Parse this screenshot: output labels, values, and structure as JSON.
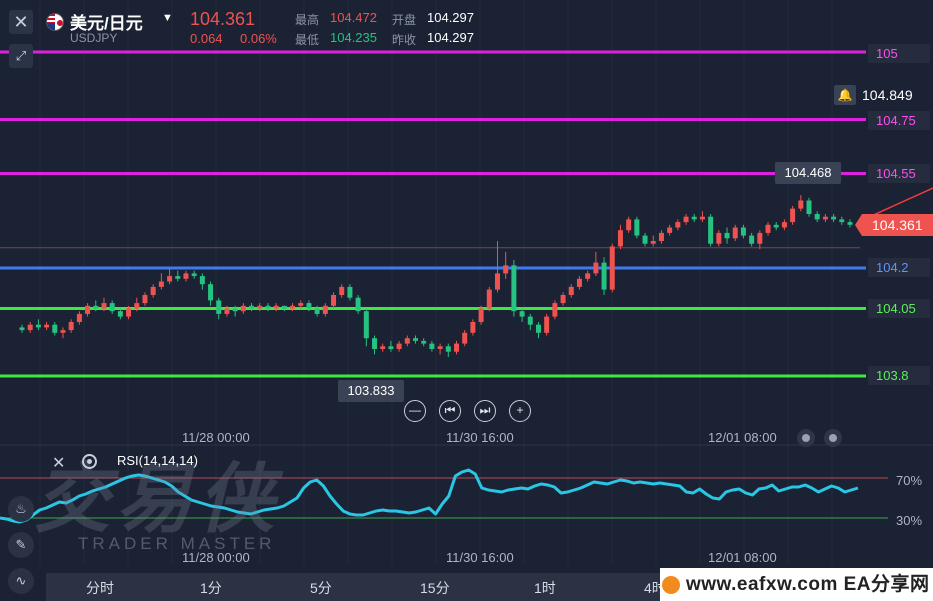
{
  "header": {
    "symbol_name": "美元/日元",
    "symbol_code": "USDJPY",
    "price": "104.361",
    "change": "0.064",
    "change_pct": "0.06%",
    "high_label": "最高",
    "high_value": "104.472",
    "low_label": "最低",
    "low_value": "104.235",
    "open_label": "开盘",
    "open_value": "104.297",
    "prev_close_label": "昨收",
    "prev_close_value": "104.297"
  },
  "price_lines": [
    {
      "label": "105",
      "color": "#e020e0"
    },
    {
      "label": "104.75",
      "color": "#e020e0"
    },
    {
      "label": "104.55",
      "color": "#e020e0"
    },
    {
      "label": "104.2",
      "color": "#3d7bf0"
    },
    {
      "label": "104.05",
      "color": "#3fe83f"
    },
    {
      "label": "103.8",
      "color": "#3fe83f"
    }
  ],
  "alert_price": "104.849",
  "current_price_tag": "104.361",
  "visible_high": "104.468",
  "visible_low": "103.833",
  "time_axis_main": [
    "11/28 00:00",
    "11/30 16:00",
    "12/01 08:00"
  ],
  "time_axis_rsi": [
    "11/28 00:00",
    "11/30 16:00",
    "12/01 08:00"
  ],
  "rsi": {
    "label": "RSI(14,14,14)",
    "upper": "70%",
    "lower": "30%",
    "upper_level": 70,
    "lower_level": 30,
    "line_color": "#29c7e6"
  },
  "watermark": {
    "title": "交易侠",
    "subtitle": "TRADER MASTER"
  },
  "timeframes": [
    "分时",
    "1分",
    "5分",
    "15分",
    "1时",
    "4时"
  ],
  "brand": "www.eafxw.com   EA分享网",
  "colors": {
    "up": "#ef5350",
    "down": "#26c281",
    "bg": "#1b2233"
  },
  "candles": [
    [
      103.98,
      103.97,
      103.99,
      103.96
    ],
    [
      103.97,
      103.99,
      104.0,
      103.96
    ],
    [
      103.99,
      103.98,
      104.01,
      103.97
    ],
    [
      103.98,
      103.99,
      104.0,
      103.97
    ],
    [
      103.99,
      103.96,
      104.0,
      103.95
    ],
    [
      103.96,
      103.97,
      103.98,
      103.94
    ],
    [
      103.97,
      104.0,
      104.01,
      103.96
    ],
    [
      104.0,
      104.03,
      104.04,
      103.99
    ],
    [
      104.03,
      104.06,
      104.07,
      104.02
    ],
    [
      104.06,
      104.05,
      104.08,
      104.04
    ],
    [
      104.05,
      104.07,
      104.09,
      104.04
    ],
    [
      104.07,
      104.04,
      104.08,
      104.03
    ],
    [
      104.04,
      104.02,
      104.05,
      104.01
    ],
    [
      104.02,
      104.05,
      104.06,
      104.01
    ],
    [
      104.05,
      104.07,
      104.09,
      104.04
    ],
    [
      104.07,
      104.1,
      104.11,
      104.06
    ],
    [
      104.1,
      104.13,
      104.14,
      104.09
    ],
    [
      104.13,
      104.15,
      104.18,
      104.12
    ],
    [
      104.15,
      104.17,
      104.2,
      104.14
    ],
    [
      104.17,
      104.16,
      104.19,
      104.15
    ],
    [
      104.16,
      104.18,
      104.19,
      104.15
    ],
    [
      104.18,
      104.17,
      104.19,
      104.16
    ],
    [
      104.17,
      104.14,
      104.18,
      104.12
    ],
    [
      104.14,
      104.08,
      104.15,
      104.06
    ],
    [
      104.08,
      104.03,
      104.09,
      104.01
    ],
    [
      104.03,
      104.05,
      104.06,
      104.02
    ],
    [
      104.05,
      104.04,
      104.06,
      104.02
    ],
    [
      104.04,
      104.06,
      104.07,
      104.03
    ],
    [
      104.06,
      104.05,
      104.07,
      104.04
    ],
    [
      104.05,
      104.06,
      104.07,
      104.04
    ],
    [
      104.06,
      104.05,
      104.07,
      104.04
    ],
    [
      104.05,
      104.06,
      104.07,
      104.04
    ],
    [
      104.06,
      104.05,
      104.06,
      104.04
    ],
    [
      104.05,
      104.06,
      104.07,
      104.04
    ],
    [
      104.06,
      104.07,
      104.08,
      104.05
    ],
    [
      104.07,
      104.05,
      104.08,
      104.04
    ],
    [
      104.05,
      104.03,
      104.06,
      104.02
    ],
    [
      104.03,
      104.06,
      104.07,
      104.02
    ],
    [
      104.06,
      104.1,
      104.11,
      104.05
    ],
    [
      104.1,
      104.13,
      104.14,
      104.09
    ],
    [
      104.13,
      104.09,
      104.14,
      104.08
    ],
    [
      104.09,
      104.04,
      104.1,
      104.03
    ],
    [
      104.04,
      103.94,
      104.05,
      103.91
    ],
    [
      103.94,
      103.9,
      103.95,
      103.88
    ],
    [
      103.9,
      103.91,
      103.92,
      103.89
    ],
    [
      103.91,
      103.9,
      103.93,
      103.89
    ],
    [
      103.9,
      103.92,
      103.93,
      103.89
    ],
    [
      103.92,
      103.94,
      103.95,
      103.91
    ],
    [
      103.94,
      103.93,
      103.95,
      103.92
    ],
    [
      103.93,
      103.92,
      103.94,
      103.91
    ],
    [
      103.92,
      103.9,
      103.93,
      103.89
    ],
    [
      103.9,
      103.91,
      103.92,
      103.88
    ],
    [
      103.91,
      103.89,
      103.92,
      103.87
    ],
    [
      103.89,
      103.92,
      103.93,
      103.88
    ],
    [
      103.92,
      103.96,
      103.97,
      103.91
    ],
    [
      103.96,
      104.0,
      104.01,
      103.95
    ],
    [
      104.0,
      104.05,
      104.06,
      103.99
    ],
    [
      104.05,
      104.12,
      104.13,
      104.04
    ],
    [
      104.12,
      104.18,
      104.3,
      104.11
    ],
    [
      104.18,
      104.21,
      104.26,
      104.16
    ],
    [
      104.21,
      104.04,
      104.23,
      104.02
    ],
    [
      104.04,
      104.02,
      104.05,
      104.0
    ],
    [
      104.02,
      103.99,
      104.03,
      103.97
    ],
    [
      103.99,
      103.96,
      104.0,
      103.94
    ],
    [
      103.96,
      104.02,
      104.03,
      103.95
    ],
    [
      104.02,
      104.07,
      104.08,
      104.01
    ],
    [
      104.07,
      104.1,
      104.11,
      104.06
    ],
    [
      104.1,
      104.13,
      104.14,
      104.09
    ],
    [
      104.13,
      104.16,
      104.17,
      104.12
    ],
    [
      104.16,
      104.18,
      104.19,
      104.15
    ],
    [
      104.18,
      104.22,
      104.26,
      104.17
    ],
    [
      104.22,
      104.12,
      104.24,
      104.1
    ],
    [
      104.12,
      104.28,
      104.29,
      104.11
    ],
    [
      104.28,
      104.34,
      104.36,
      104.27
    ],
    [
      104.34,
      104.38,
      104.39,
      104.33
    ],
    [
      104.38,
      104.32,
      104.39,
      104.31
    ],
    [
      104.32,
      104.29,
      104.33,
      104.28
    ],
    [
      104.29,
      104.3,
      104.32,
      104.28
    ],
    [
      104.3,
      104.33,
      104.34,
      104.29
    ],
    [
      104.33,
      104.35,
      104.36,
      104.32
    ],
    [
      104.35,
      104.37,
      104.38,
      104.34
    ],
    [
      104.37,
      104.39,
      104.4,
      104.36
    ],
    [
      104.39,
      104.38,
      104.4,
      104.37
    ],
    [
      104.38,
      104.39,
      104.41,
      104.37
    ],
    [
      104.39,
      104.29,
      104.4,
      104.28
    ],
    [
      104.29,
      104.33,
      104.34,
      104.28
    ],
    [
      104.33,
      104.31,
      104.35,
      104.29
    ],
    [
      104.31,
      104.35,
      104.36,
      104.3
    ],
    [
      104.35,
      104.32,
      104.36,
      104.31
    ],
    [
      104.32,
      104.29,
      104.33,
      104.28
    ],
    [
      104.29,
      104.33,
      104.34,
      104.27
    ],
    [
      104.33,
      104.36,
      104.37,
      104.32
    ],
    [
      104.36,
      104.35,
      104.37,
      104.34
    ],
    [
      104.35,
      104.37,
      104.38,
      104.34
    ],
    [
      104.37,
      104.42,
      104.43,
      104.36
    ],
    [
      104.42,
      104.45,
      104.47,
      104.41
    ],
    [
      104.45,
      104.4,
      104.46,
      104.39
    ],
    [
      104.4,
      104.38,
      104.41,
      104.37
    ],
    [
      104.38,
      104.39,
      104.4,
      104.37
    ],
    [
      104.39,
      104.38,
      104.4,
      104.37
    ],
    [
      104.38,
      104.37,
      104.39,
      104.36
    ],
    [
      104.37,
      104.36,
      104.38,
      104.35
    ]
  ],
  "rsi_values": [
    30,
    29,
    27,
    26,
    28,
    33,
    38,
    40,
    43,
    46,
    45,
    48,
    52,
    54,
    57,
    59,
    61,
    64,
    67,
    70,
    72,
    73,
    72,
    70,
    68,
    66,
    62,
    56,
    52,
    48,
    46,
    44,
    42,
    41,
    40,
    38,
    36,
    35,
    34,
    36,
    38,
    39,
    40,
    42,
    46,
    50,
    60,
    66,
    68,
    62,
    52,
    44,
    37,
    34,
    33,
    33,
    35,
    37,
    38,
    37,
    37,
    36,
    35,
    36,
    38,
    40,
    34,
    44,
    52,
    72,
    76,
    78,
    74,
    60,
    58,
    57,
    56,
    58,
    59,
    60,
    59,
    62,
    64,
    63,
    61,
    55,
    56,
    58,
    60,
    63,
    66,
    65,
    64,
    66,
    68,
    67,
    65,
    66,
    65,
    64,
    65,
    64,
    63,
    62,
    56,
    55,
    59,
    54,
    50,
    49,
    56,
    58,
    59,
    55,
    53,
    59,
    60,
    63,
    57,
    59,
    61,
    61,
    63,
    60,
    56,
    59,
    62,
    60,
    56,
    58,
    60
  ]
}
